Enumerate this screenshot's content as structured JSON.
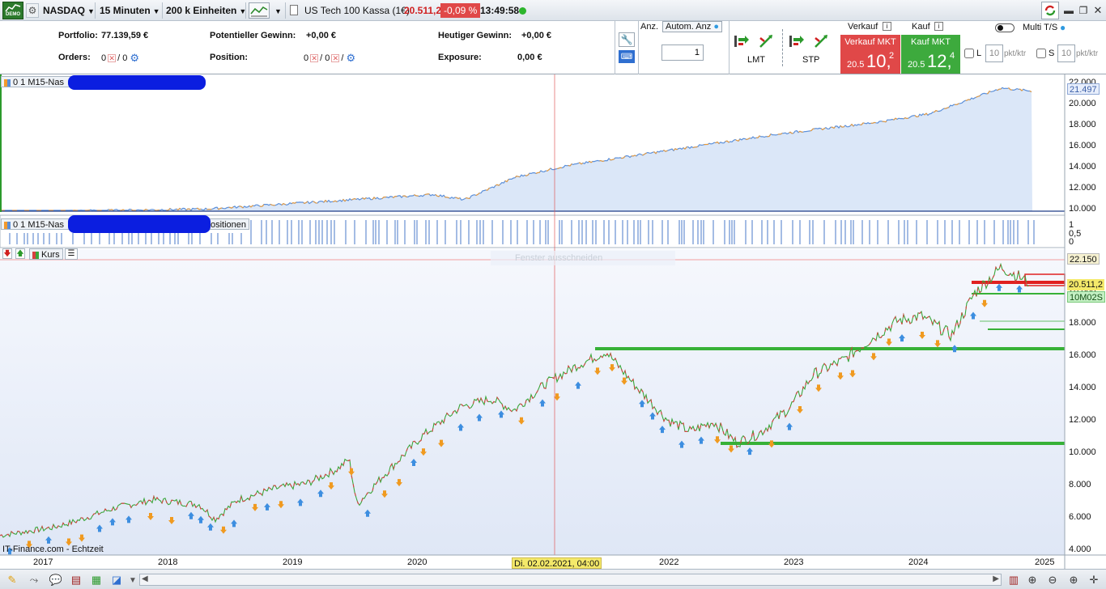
{
  "topbar": {
    "demo_label": "DEMO",
    "instrument": "NASDAQ",
    "timeframe": "15 Minuten",
    "units": "200 k Einheiten",
    "title": "US Tech 100 Kassa (1€)",
    "price": "20.511,2",
    "change": "-0,09 %",
    "time": "13:49:58"
  },
  "portfolio": {
    "portfolio_label": "Portfolio:",
    "portfolio_value": "77.139,59 €",
    "gewinn_label": "Potentieller Gewinn:",
    "gewinn_value": "+0,00 €",
    "heute_label": "Heutiger Gewinn:",
    "heute_value": "+0,00 €",
    "orders_label": "Orders:",
    "orders_a": "0",
    "orders_b": "/ 0",
    "position_label": "Position:",
    "position_a": "0",
    "position_b": "/ 0",
    "position_c": "/",
    "exposure_label": "Exposure:",
    "exposure_value": "0,00 €"
  },
  "order": {
    "anz_label": "Anz.",
    "autom_label": "Autom. Anz",
    "qty": "1",
    "lmt": "LMT",
    "stp": "STP",
    "verkauf": "Verkauf",
    "kauf": "Kauf",
    "sell_title": "Verkauf MKT",
    "sell_small": "20.5",
    "sell_big": "10,",
    "sell_sup": "2",
    "buy_title": "Kauf MKT",
    "buy_small": "20.5",
    "buy_big": "12,",
    "buy_sup": "4",
    "multi": "Multi T/S",
    "l_label": "L",
    "l_value": "10",
    "l_unit": "pkt/ktr",
    "s_label": "S",
    "s_value": "10",
    "s_unit": "pkt/ktr"
  },
  "pane1": {
    "header": "0 1 M15-Nas",
    "price_tag": "21.497",
    "axis": [
      "22.000",
      "20.000",
      "18.000",
      "16.000",
      "14.000",
      "12.000",
      "10.000"
    ]
  },
  "pane2": {
    "header": "0 1 M15-Nas",
    "header_tail": "ositionen",
    "axis": [
      "1",
      "0,5",
      "0"
    ]
  },
  "pane3": {
    "kurs_label": "Kurs",
    "watermark": "Fenster ausschneiden",
    "price_top": "22.150",
    "price_now": "20.511,2",
    "timer": "10M02S",
    "axis": [
      "20.000",
      "18.000",
      "16.000",
      "14.000",
      "12.000",
      "10.000",
      "8.000",
      "6.000",
      "4.000"
    ],
    "footer": "IT-Finance.com - Echtzeit"
  },
  "xaxis": {
    "years": [
      "2017",
      "2018",
      "2019",
      "2020",
      "2022",
      "2023",
      "2024",
      "2025"
    ],
    "cursor_label": "Di. 02.02.2021, 04:00"
  },
  "colors": {
    "accent_red": "#e04848",
    "accent_green": "#3daa3d",
    "line_blue": "#1f3c88",
    "area_fill": "#dbe7f8"
  }
}
